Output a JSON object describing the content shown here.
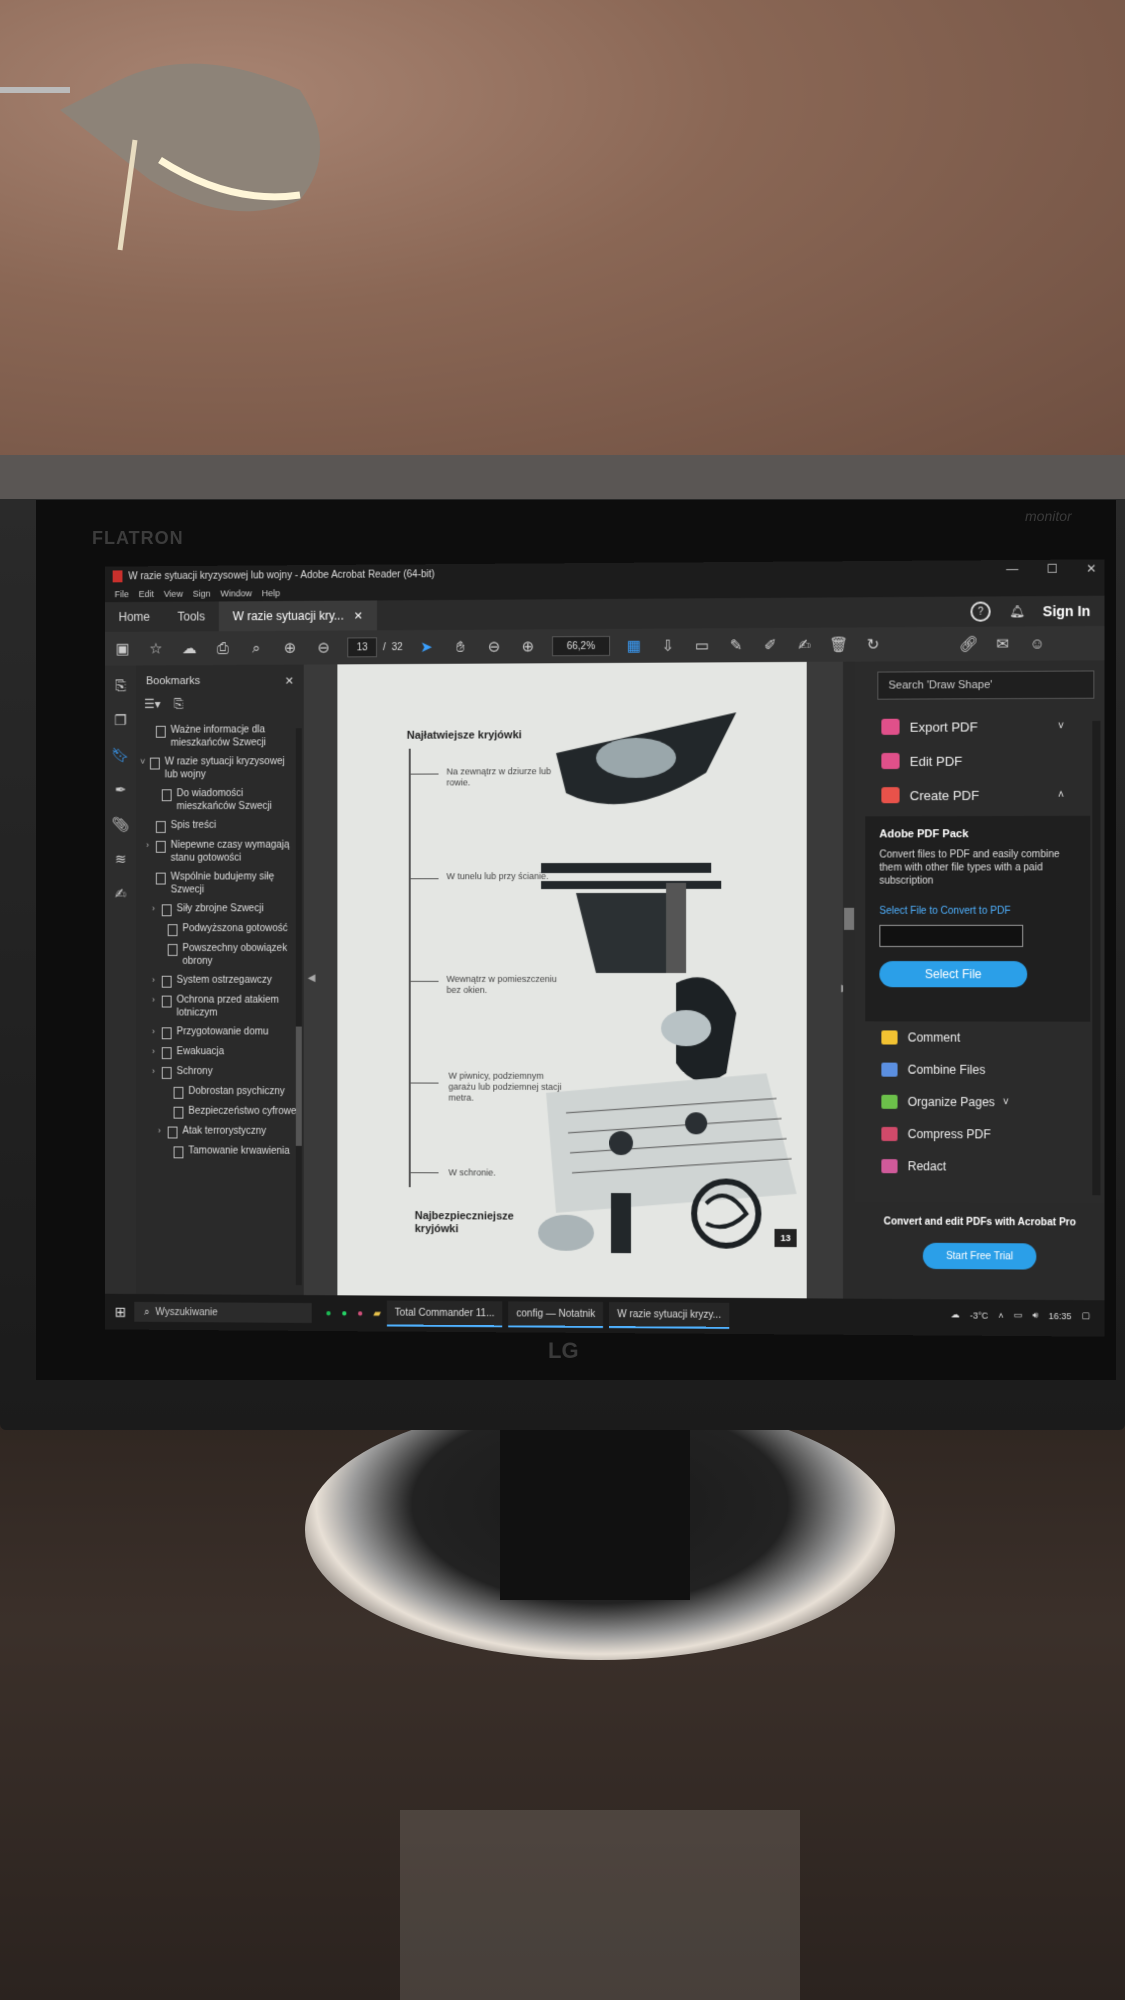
{
  "window": {
    "title": "W razie sytuacji kryzysowej lub wojny - Adobe Acrobat Reader (64-bit)",
    "menu": [
      "File",
      "Edit",
      "View",
      "Sign",
      "Window",
      "Help"
    ]
  },
  "tabs": {
    "home": "Home",
    "tools": "Tools",
    "doc_tab": "W razie sytuacji kry...",
    "sign_in": "Sign In"
  },
  "toolbar": {
    "page_current": "13",
    "page_separator": "/",
    "page_total": "32",
    "zoom": "66,2%"
  },
  "bookmarks": {
    "title": "Bookmarks",
    "items": [
      {
        "label": "Ważne informacje dla mieszkańców Szwecji",
        "indent": 1,
        "chevron": ""
      },
      {
        "label": "W razie sytuacji kryzysowej lub wojny",
        "indent": 0,
        "chevron": "˅"
      },
      {
        "label": "Do wiadomości mieszkańców Szwecji",
        "indent": 2,
        "chevron": ""
      },
      {
        "label": "Spis treści",
        "indent": 1,
        "chevron": ""
      },
      {
        "label": "Niepewne czasy wymagają stanu gotowości",
        "indent": 1,
        "chevron": "›"
      },
      {
        "label": "Wspólnie budujemy siłę Szwecji",
        "indent": 1,
        "chevron": ""
      },
      {
        "label": "Siły zbrojne Szwecji",
        "indent": 2,
        "chevron": "›"
      },
      {
        "label": "Podwyższona gotowość",
        "indent": 3,
        "chevron": ""
      },
      {
        "label": "Powszechny obowiązek obrony",
        "indent": 3,
        "chevron": ""
      },
      {
        "label": "System ostrzegawczy",
        "indent": 2,
        "chevron": "›"
      },
      {
        "label": "Ochrona przed atakiem lotniczym",
        "indent": 2,
        "chevron": "›"
      },
      {
        "label": "Przygotowanie domu",
        "indent": 2,
        "chevron": "›"
      },
      {
        "label": "Ewakuacja",
        "indent": 2,
        "chevron": "›"
      },
      {
        "label": "Schrony",
        "indent": 2,
        "chevron": "›"
      },
      {
        "label": "Dobrostan psychiczny",
        "indent": 4,
        "chevron": ""
      },
      {
        "label": "Bezpieczeństwo cyfrowe",
        "indent": 4,
        "chevron": ""
      },
      {
        "label": "Atak terrorystyczny",
        "indent": 3,
        "chevron": "›"
      },
      {
        "label": "Tamowanie krwawienia",
        "indent": 4,
        "chevron": ""
      }
    ]
  },
  "page": {
    "title": "Najłatwiejsze kryjówki",
    "labels": [
      "Na zewnątrz w dziurze lub rowie.",
      "W tunelu lub przy ścianie.",
      "Wewnątrz w pomieszczeniu bez okien.",
      "W piwnicy, podziemnym garażu lub podziemnej stacji metra.",
      "W schronie."
    ],
    "bottom_title": "Najbezpieczniejsze kryjówki",
    "page_number": "13"
  },
  "right_panel": {
    "search_placeholder": "Search 'Draw Shape'",
    "export_pdf": "Export PDF",
    "edit_pdf": "Edit PDF",
    "create_pdf": "Create PDF",
    "pack_title": "Adobe PDF Pack",
    "pack_desc": "Convert files to PDF and easily combine them with other file types with a paid subscription",
    "pack_link": "Select File to Convert to PDF",
    "select_file": "Select File",
    "comment": "Comment",
    "combine": "Combine Files",
    "organize": "Organize Pages",
    "compress": "Compress PDF",
    "redact": "Redact",
    "promo_text": "Convert and edit PDFs with Acrobat Pro",
    "trial": "Start Free Trial",
    "colors": {
      "export": "#e0508a",
      "edit": "#e0508a",
      "create": "#e8524a",
      "comment": "#f2c232",
      "combine": "#5b8fe0",
      "organize": "#6cc04a",
      "compress": "#d14a6a",
      "redact": "#d05a9a",
      "accent": "#2b9fe8"
    }
  },
  "taskbar": {
    "search": "Wyszukiwanie",
    "apps": [
      "Total Commander 11...",
      "config — Notatnik",
      "W razie sytuacji kryzy..."
    ],
    "weather": "-3°C",
    "time": "16:35"
  },
  "monitor": {
    "brand_left": "FLATRON",
    "brand_right": "monitor",
    "logo": "LG"
  }
}
